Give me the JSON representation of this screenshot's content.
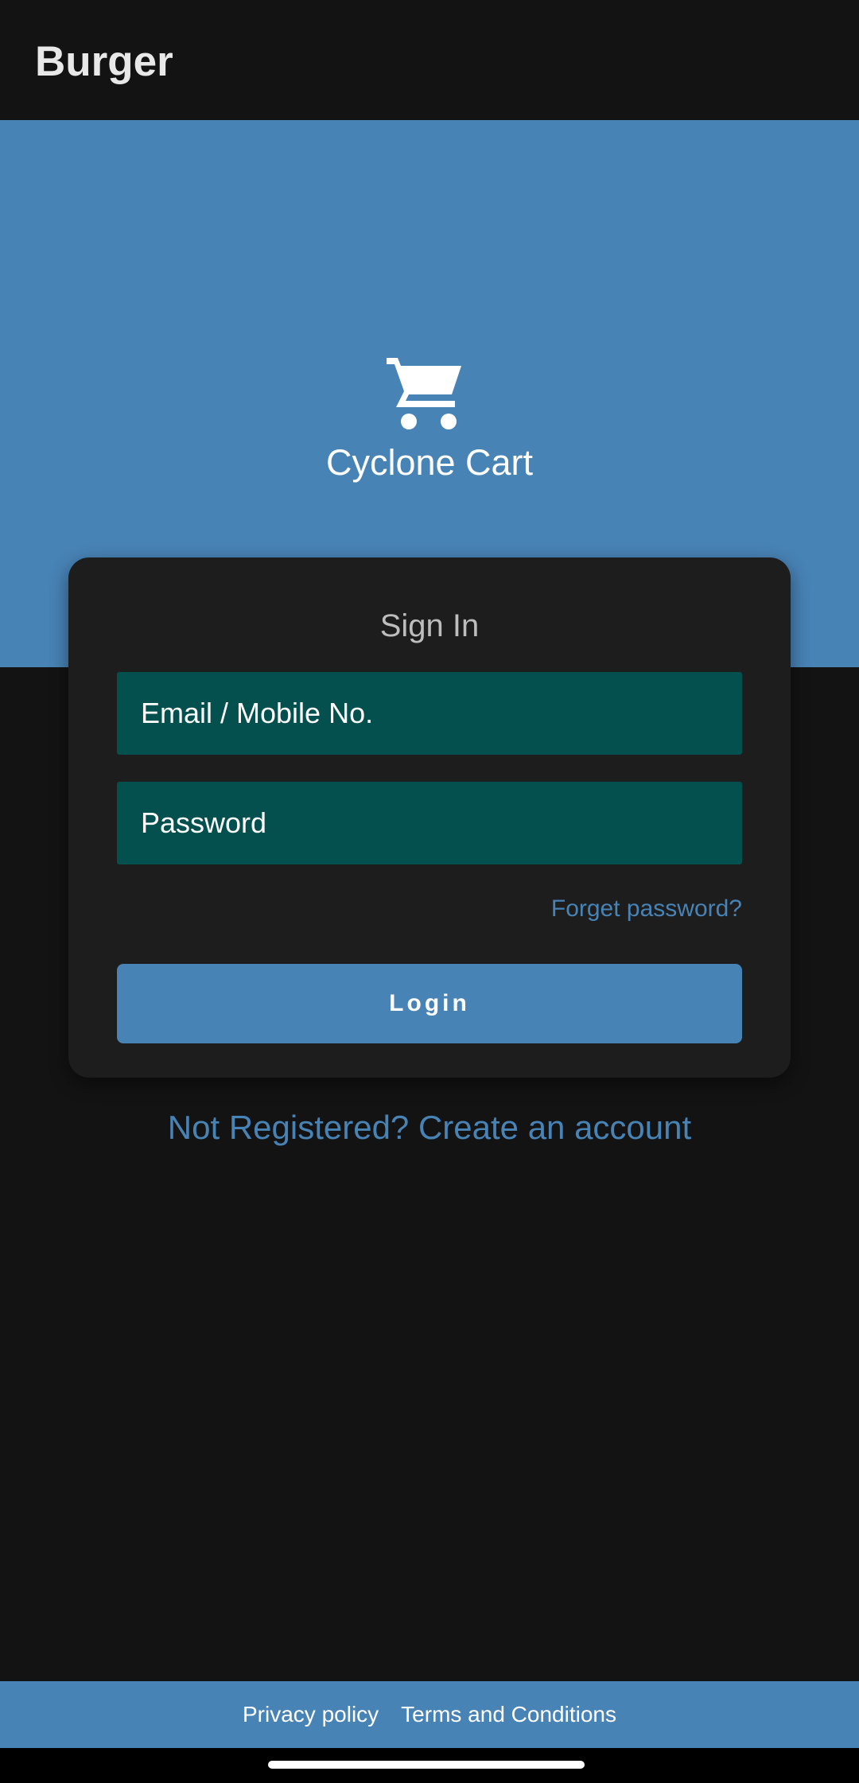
{
  "app_bar": {
    "title": "Burger"
  },
  "hero": {
    "icon": "shopping-cart-icon",
    "brand_name": "Cyclone Cart",
    "background_color": "#4883b6"
  },
  "sign_in_card": {
    "title": "Sign In",
    "email_placeholder": "Email / Mobile No.",
    "email_value": "",
    "password_placeholder": "Password",
    "password_value": "",
    "forgot_password_label": "Forget password?",
    "login_label": "Login",
    "field_color": "#03504e"
  },
  "register": {
    "label": "Not Registered? Create an account"
  },
  "footer": {
    "privacy_label": "Privacy policy",
    "terms_label": "Terms and Conditions"
  },
  "colors": {
    "accent": "#4883b6",
    "background": "#131313",
    "card": "#1d1d1d"
  }
}
